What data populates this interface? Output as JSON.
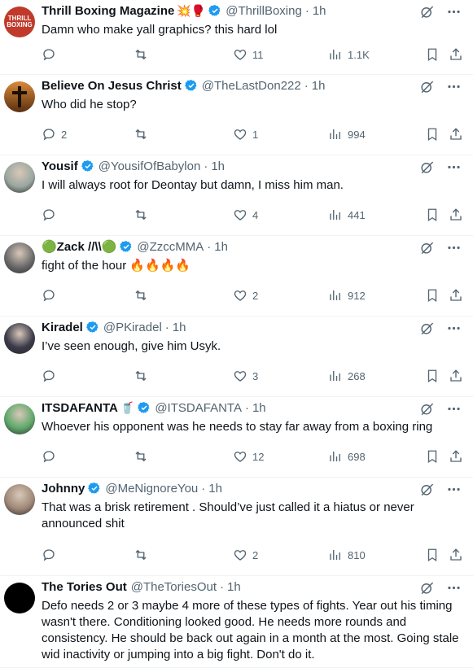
{
  "tweets": [
    {
      "name": "Thrill Boxing Magazine",
      "emoji": "💥🥊",
      "handle": "@ThrillBoxing",
      "time": "1h",
      "text": "Damn who make yall graphics? this hard lol",
      "replies": "",
      "likes": "11",
      "views": "1.1K",
      "avatar_color": "#c0392b",
      "avatar_text": "THRILL BOXING"
    },
    {
      "name": "Believe On Jesus Christ",
      "emoji": "",
      "handle": "@TheLastDon222",
      "time": "1h",
      "text": "Who did he stop?",
      "replies": "2",
      "likes": "1",
      "views": "994",
      "avatar_color": "#8a5a2b",
      "avatar_text": ""
    },
    {
      "name": "Yousif",
      "emoji": "",
      "handle": "@YousifOfBabylon",
      "time": "1h",
      "text": "I will always root for Deontay but damn, I miss him man.",
      "replies": "",
      "likes": "4",
      "views": "441",
      "avatar_color": "#9aa7a0",
      "avatar_text": ""
    },
    {
      "name": "🟢Zack //\\\\🟢",
      "emoji": "",
      "handle": "@ZzccMMA",
      "time": "1h",
      "text": "fight of the hour 🔥🔥🔥🔥",
      "replies": "",
      "likes": "2",
      "views": "912",
      "avatar_color": "#6b6b6b",
      "avatar_text": ""
    },
    {
      "name": "Kiradel",
      "emoji": "",
      "handle": "@PKiradel",
      "time": "1h",
      "text": "I’ve seen enough, give him Usyk.",
      "replies": "",
      "likes": "3",
      "views": "268",
      "avatar_color": "#3a3a4a",
      "avatar_text": ""
    },
    {
      "name": "ITSDAFANTA",
      "emoji": "🥤",
      "handle": "@ITSDAFANTA",
      "time": "1h",
      "text": "Whoever his opponent was he needs to stay far away from a boxing ring",
      "replies": "",
      "likes": "12",
      "views": "698",
      "avatar_color": "#5fa86b",
      "avatar_text": ""
    },
    {
      "name": "Johnny",
      "emoji": "",
      "handle": "@MeNignoreYou",
      "time": "1h",
      "text": "That was a brisk retirement . Should’ve just called it a hiatus  or never announced shit",
      "replies": "",
      "likes": "2",
      "views": "810",
      "avatar_color": "#a08878",
      "avatar_text": ""
    },
    {
      "name": "The Tories Out",
      "emoji": "",
      "handle": "@TheToriesOut",
      "time": "1h",
      "text": "Defo needs 2 or 3 maybe 4 more of these types of fights. Year out his timing wasn't there. Conditioning looked good. He needs more rounds and consistency. He should be back out again in a month at the most. Going stale wid inactivity or jumping into a big fight. Don't do it.",
      "replies": "",
      "likes": "",
      "views": "",
      "avatar_color": "#000000",
      "avatar_text": ""
    }
  ],
  "ui": {
    "separator": "·",
    "accent_color": "#1d9bf0",
    "muted_color": "#536471"
  }
}
